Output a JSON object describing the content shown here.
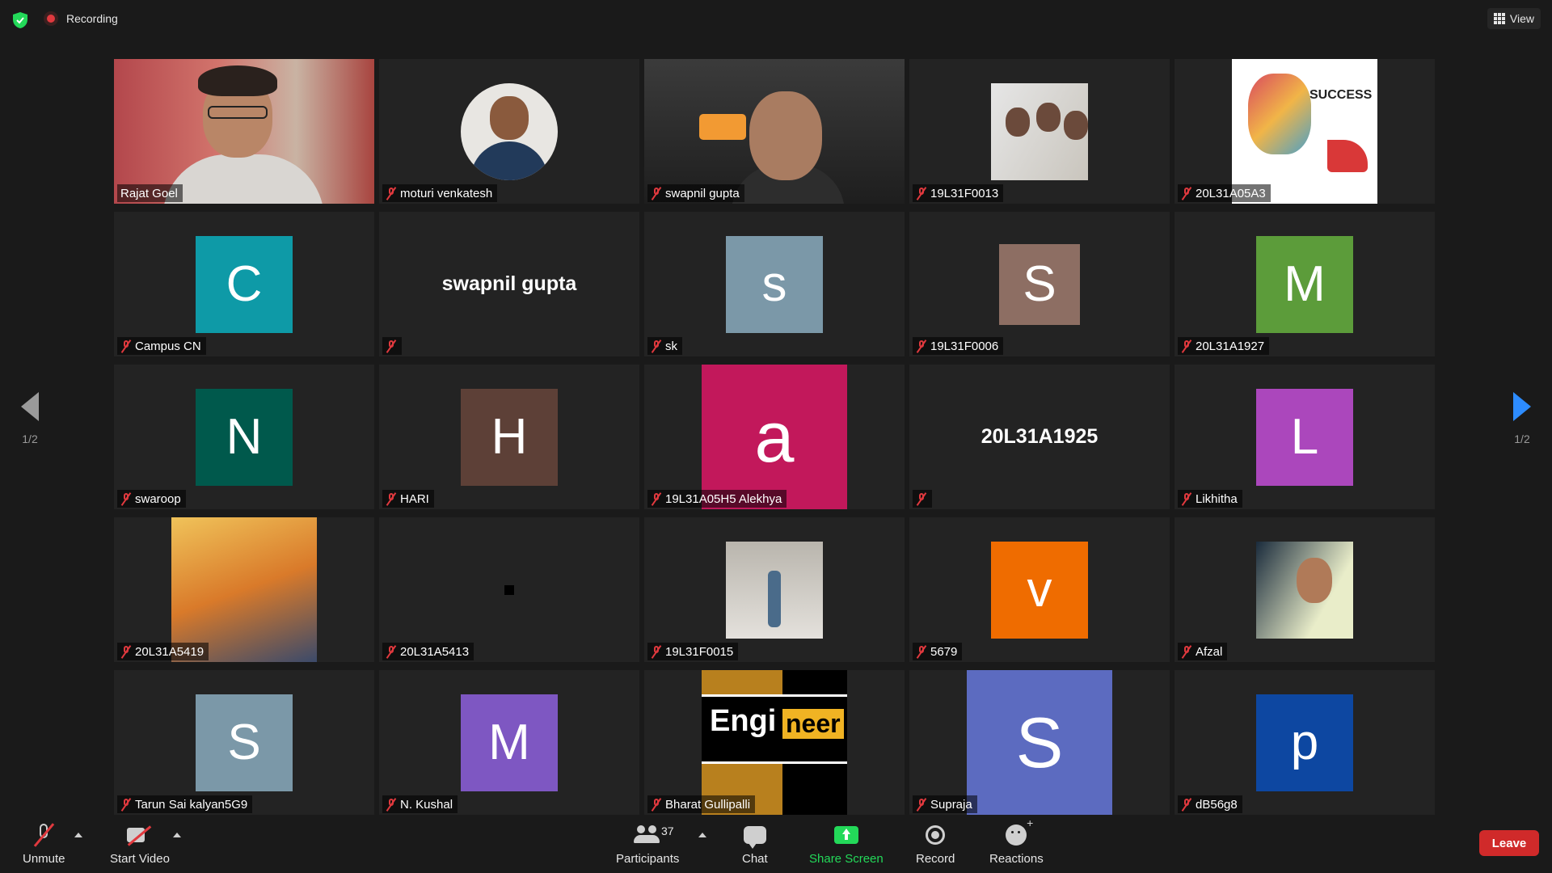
{
  "top": {
    "recording_label": "Recording",
    "view_label": "View"
  },
  "pager": {
    "left": "1/2",
    "right": "1/2"
  },
  "tiles": [
    {
      "name": "Rajat Goel"
    },
    {
      "name": "moturi venkatesh"
    },
    {
      "name": "swapnil gupta"
    },
    {
      "name": "19L31F0013"
    },
    {
      "name": "20L31A05A3"
    },
    {
      "name": "Campus CN",
      "initial": "C",
      "color": "#0e9aa7"
    },
    {
      "name": "",
      "card": "swapnil gupta"
    },
    {
      "name": "sk",
      "initial": "s",
      "color": "#7b98a8"
    },
    {
      "name": "19L31F0006",
      "initial": "S",
      "color": "#8d6e63"
    },
    {
      "name": "20L31A1927",
      "initial": "M",
      "color": "#5c9c3a"
    },
    {
      "name": "swaroop",
      "initial": "N",
      "color": "#00594c"
    },
    {
      "name": "HARI",
      "initial": "H",
      "color": "#5d4037"
    },
    {
      "name": "19L31A05H5 Alekhya",
      "initial": "a",
      "color": "#c2185b"
    },
    {
      "name": "",
      "card": "20L31A1925"
    },
    {
      "name": "Likhitha",
      "initial": "L",
      "color": "#ab47bc"
    },
    {
      "name": "20L31A5419"
    },
    {
      "name": "20L31A5413"
    },
    {
      "name": "19L31F0015"
    },
    {
      "name": "5679",
      "initial": "v",
      "color": "#ef6c00"
    },
    {
      "name": "Afzal"
    },
    {
      "name": "Tarun Sai kalyan5G9",
      "initial": "S",
      "color": "#7b98a8"
    },
    {
      "name": "N. Kushal",
      "initial": "M",
      "color": "#7e57c2"
    },
    {
      "name": "Bharat Gullipalli"
    },
    {
      "name": "Supraja",
      "initial": "S",
      "color": "#5c6bc0"
    },
    {
      "name": "dB56g8",
      "initial": "p",
      "color": "#0d47a1"
    }
  ],
  "photos": {
    "success_text": "SUCCESS",
    "engineer_word1": "Engi",
    "engineer_word2": "neer"
  },
  "toolbar": {
    "unmute": "Unmute",
    "start_video": "Start Video",
    "participants": "Participants",
    "participants_count": "37",
    "chat": "Chat",
    "share_screen": "Share Screen",
    "record": "Record",
    "reactions": "Reactions",
    "leave": "Leave"
  },
  "colors": {
    "active_speaker": "#c8e26f",
    "share_green": "#23d959",
    "leave_red": "#d02a2a",
    "accent_blue": "#2d8cff"
  }
}
